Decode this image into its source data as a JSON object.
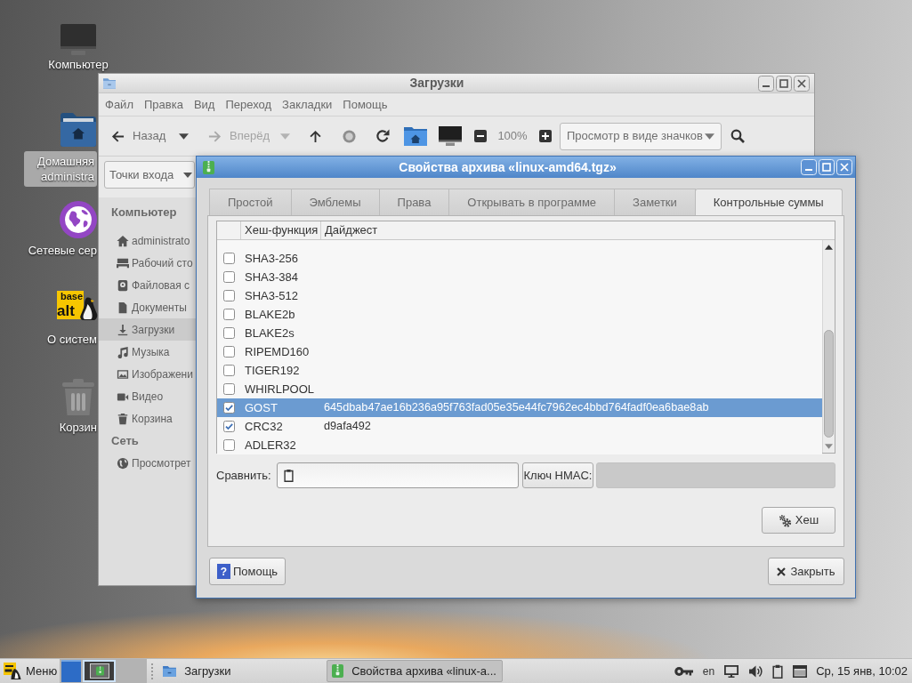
{
  "desktop": {
    "icons": [
      {
        "kind": "computer",
        "lines": [
          "Компьютер"
        ],
        "selected": false
      },
      {
        "kind": "home",
        "lines": [
          "Домашняя",
          "administra"
        ],
        "selected": true
      },
      {
        "kind": "network",
        "lines": [
          "Сетевые сер"
        ],
        "selected": false
      },
      {
        "kind": "about",
        "logo_words": [
          "base",
          "alt"
        ],
        "lines": [
          "О систем"
        ],
        "selected": false
      },
      {
        "kind": "trash",
        "lines": [
          "Корзин"
        ],
        "selected": false
      }
    ]
  },
  "file_manager": {
    "title": "Загрузки",
    "menu": [
      "Файл",
      "Правка",
      "Вид",
      "Переход",
      "Закладки",
      "Помощь"
    ],
    "toolbar": [
      {
        "kind": "back",
        "label": "Назад",
        "disabled": false
      },
      {
        "kind": "history",
        "disabled": false
      },
      {
        "kind": "forward",
        "label": "Вперёд",
        "disabled": true
      },
      {
        "kind": "history",
        "disabled": true
      },
      {
        "kind": "up",
        "disabled": false
      },
      {
        "kind": "stop",
        "disabled": true
      },
      {
        "kind": "reload",
        "disabled": false
      },
      {
        "kind": "home",
        "disabled": false
      },
      {
        "kind": "computer",
        "disabled": false
      },
      {
        "kind": "zoom_out",
        "disabled": false
      },
      {
        "kind": "zoom_level",
        "label": "100%",
        "disabled": false
      },
      {
        "kind": "zoom_in",
        "disabled": false
      },
      {
        "kind": "view",
        "label": "Просмотр в виде значков",
        "disabled": false
      },
      {
        "kind": "search",
        "disabled": false
      }
    ],
    "places_select": "Точки входа",
    "sidebar": [
      {
        "heading": "Компьютер",
        "items": [
          {
            "kind": "home",
            "label": "administrato",
            "selected": false
          },
          {
            "kind": "desktop",
            "label": "Рабочий сто",
            "selected": false
          },
          {
            "kind": "drive",
            "label": "Файловая с",
            "selected": false
          },
          {
            "kind": "document",
            "label": "Документы",
            "selected": false
          },
          {
            "kind": "download",
            "label": "Загрузки",
            "selected": true
          },
          {
            "kind": "music",
            "label": "Музыка",
            "selected": false
          },
          {
            "kind": "image",
            "label": "Изображени",
            "selected": false
          },
          {
            "kind": "video",
            "label": "Видео",
            "selected": false
          },
          {
            "kind": "trash",
            "label": "Корзина",
            "selected": false
          }
        ]
      },
      {
        "heading": "Сеть",
        "items": [
          {
            "kind": "network",
            "label": "Просмотрет",
            "selected": false
          }
        ]
      }
    ]
  },
  "dialog": {
    "title": "Свойства архива «linux-amd64.tgz»",
    "tabs": [
      {
        "label": "Простой",
        "selected": false
      },
      {
        "label": "Эмблемы",
        "selected": false
      },
      {
        "label": "Права",
        "selected": false
      },
      {
        "label": "Открывать в программе",
        "selected": false
      },
      {
        "label": "Заметки",
        "selected": false
      },
      {
        "label": "Контрольные суммы",
        "selected": true
      }
    ],
    "checksums": {
      "columns": [
        "Хеш-функция",
        "Дайджест"
      ],
      "rows": [
        {
          "name": "SHA3-256",
          "checked": false,
          "selected": false
        },
        {
          "name": "SHA3-384",
          "checked": false,
          "selected": false
        },
        {
          "name": "SHA3-512",
          "checked": false,
          "selected": false
        },
        {
          "name": "BLAKE2b",
          "checked": false,
          "selected": false
        },
        {
          "name": "BLAKE2s",
          "checked": false,
          "selected": false
        },
        {
          "name": "RIPEMD160",
          "checked": false,
          "selected": false
        },
        {
          "name": "TIGER192",
          "checked": false,
          "selected": false
        },
        {
          "name": "WHIRLPOOL",
          "checked": false,
          "selected": false
        },
        {
          "name": "GOST",
          "checked": true,
          "selected": true,
          "digest": "645dbab47ae16b236a95f763fad05e35e44fc7962ec4bbd764fadf0ea6bae8ab"
        },
        {
          "name": "CRC32",
          "checked": true,
          "selected": false,
          "digest": "d9afa492"
        },
        {
          "name": "ADLER32",
          "checked": false,
          "selected": false
        }
      ]
    },
    "compare_label": "Сравнить:",
    "hmac_button": "Ключ HMAC:",
    "hmac_field": {
      "disabled": true
    },
    "hash_button": "Хеш",
    "help_button": {
      "glyph": "?",
      "label": "Помощь"
    },
    "close_button": "Закрыть"
  },
  "taskbar": {
    "menu": "Меню",
    "workspaces": [
      {
        "selected": false,
        "has_windows": false
      },
      {
        "selected": true,
        "has_windows": true
      }
    ],
    "tasks": [
      {
        "kind": "folder",
        "label": "Загрузки",
        "selected": false
      },
      {
        "kind": "archive",
        "label": "Свойства архива «linux-a...",
        "selected": true
      }
    ],
    "tray": [
      {
        "kind": "key"
      },
      {
        "kind": "language",
        "label": "en"
      },
      {
        "kind": "monitor"
      },
      {
        "kind": "volume"
      },
      {
        "kind": "clipboard"
      },
      {
        "kind": "display"
      }
    ],
    "clock": "Ср, 15 янв, 10:02"
  }
}
